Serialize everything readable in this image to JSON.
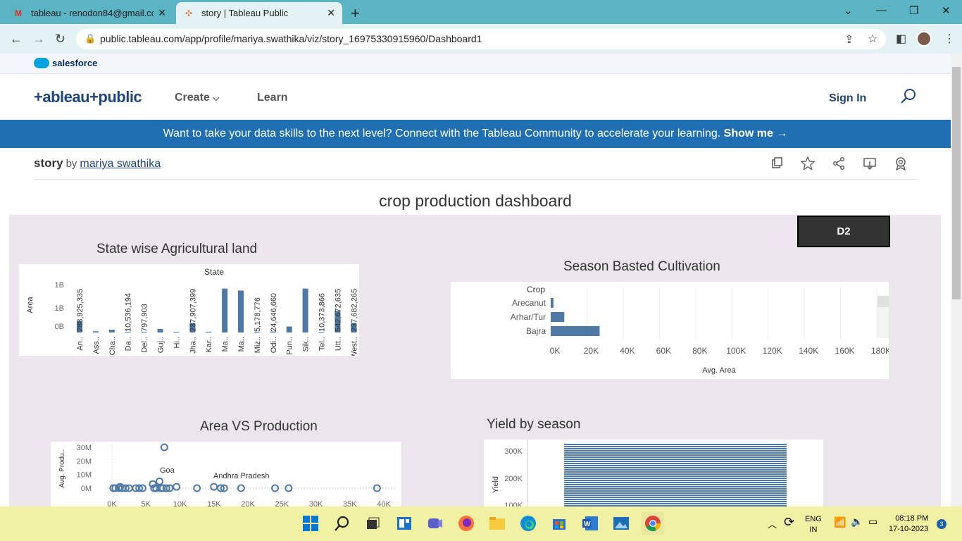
{
  "browser": {
    "tabs": [
      {
        "title": "tableau - renodon84@gmail.com",
        "icon": "gmail-icon"
      },
      {
        "title": "story | Tableau Public",
        "icon": "tableau-icon"
      }
    ],
    "url": "public.tableau.com/app/profile/mariya.swathika/viz/story_16975330915960/Dashboard1"
  },
  "salesforce": {
    "label": "salesforce"
  },
  "header": {
    "logo": "+ableau+public",
    "nav": [
      {
        "label": "Create"
      },
      {
        "label": "Learn"
      }
    ],
    "signin": "Sign In"
  },
  "banner": {
    "text": "Want to take your data skills to the next level? Connect with the Tableau Community to accelerate your learning.",
    "cta": "Show me →"
  },
  "viz": {
    "name": "story",
    "by": "by",
    "author": "mariya swathika",
    "dashboard_title": "crop production dashboard",
    "d2_button": "D2"
  },
  "colors": {
    "bar": "#4e79a7",
    "dashboard_bg": "#ece5ee",
    "banner": "#1f6fb2"
  },
  "chart_data": [
    {
      "type": "bar",
      "title": "State wise Agricultural land",
      "header": "State",
      "ylabel": "Area",
      "yticks": [
        "1B",
        "1B",
        "0B"
      ],
      "categories": [
        "An..",
        "Ass..",
        "Cha..",
        "Da..",
        "Del..",
        "Guj..",
        "Hi..",
        "Jha..",
        "Kar..",
        "Ma..",
        "Ma..",
        "Miz..",
        "Odi..",
        "Pun..",
        "Sik..",
        "Tel..",
        "Utt..",
        "West.."
      ],
      "values": [
        288925335,
        30000000,
        70000000,
        10536194,
        797903,
        90000000,
        5000000,
        237907399,
        20000000,
        1100000000,
        1050000000,
        5178776,
        24646660,
        150000000,
        1100000000,
        10373866,
        542672635,
        237682265
      ],
      "labels": [
        "288,925,335",
        "10,536,194",
        "797,903",
        "237,907,399",
        "5,178,776",
        "24,646,660",
        "10,373,866",
        "542,672,635",
        "237,682,265"
      ]
    },
    {
      "type": "bar",
      "orientation": "horizontal",
      "title": "Season Basted  Cultivation",
      "header": "Crop",
      "categories": [
        "Arecanut",
        "Arhar/Tur",
        "Bajra"
      ],
      "values": [
        1500,
        7500,
        27000
      ],
      "xticks": [
        "0K",
        "20K",
        "40K",
        "60K",
        "80K",
        "100K",
        "120K",
        "140K",
        "160K",
        "180K"
      ],
      "xlabel": "Avg. Area",
      "xlim": [
        0,
        180000
      ]
    },
    {
      "type": "scatter",
      "title": "Area VS Production",
      "ylabel": "Avg. Produ..",
      "yticks": [
        "30M",
        "20M",
        "10M",
        "0M"
      ],
      "xticks": [
        "0K",
        "5K",
        "10K",
        "15K",
        "20K",
        "25K",
        "30K",
        "35K",
        "40K"
      ],
      "annotations": [
        "Goa",
        "Andhra Pradesh"
      ],
      "points": [
        [
          0.2,
          0
        ],
        [
          0.5,
          0
        ],
        [
          1,
          0
        ],
        [
          1.2,
          1
        ],
        [
          1.5,
          0
        ],
        [
          2,
          0
        ],
        [
          2.5,
          0
        ],
        [
          3.5,
          0
        ],
        [
          4,
          0
        ],
        [
          4.5,
          0
        ],
        [
          6,
          3
        ],
        [
          6.2,
          0
        ],
        [
          6.5,
          0
        ],
        [
          7,
          5
        ],
        [
          7.2,
          0
        ],
        [
          7.5,
          0
        ],
        [
          7.7,
          30
        ],
        [
          8,
          0
        ],
        [
          8.5,
          0
        ],
        [
          9.5,
          1
        ],
        [
          12.5,
          0
        ],
        [
          15,
          1
        ],
        [
          16,
          0
        ],
        [
          16.5,
          0
        ],
        [
          19,
          0
        ],
        [
          24,
          0
        ],
        [
          26,
          0
        ],
        [
          39,
          0
        ]
      ]
    },
    {
      "type": "bar",
      "title": "Yield by season",
      "ylabel": "Yield",
      "yticks": [
        "300K",
        "200K",
        "100K"
      ]
    }
  ],
  "taskbar": {
    "lang": [
      "ENG",
      "IN"
    ],
    "time": "08:18 PM",
    "date": "17-10-2023",
    "badge": "3"
  }
}
